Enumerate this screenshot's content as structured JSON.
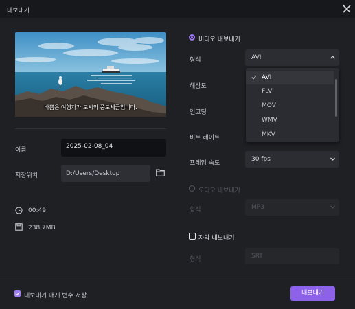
{
  "window": {
    "title": "내보내기"
  },
  "preview": {
    "subtitle": "바쁨은 여행자가 도시의 풍토세금입니다."
  },
  "file": {
    "name_label": "이름",
    "name_value": "2025-02-08_04",
    "location_label": "저장위치",
    "location_value": "D:/Users/Desktop",
    "duration": "00:49",
    "size": "238.7MB"
  },
  "video_export": {
    "title": "비디오 내보내기",
    "format_label": "형식",
    "format_value": "AVI",
    "resolution_label": "해상도",
    "encoding_label": "인코딩",
    "bitrate_label": "비트 레이트",
    "framerate_label": "프레임 속도",
    "framerate_value": "30  fps",
    "format_options": [
      "AVI",
      "FLV",
      "MOV",
      "WMV",
      "MKV"
    ]
  },
  "audio_export": {
    "title": "오디오 내보내기",
    "format_label": "형식",
    "format_value": "MP3"
  },
  "subtitle_export": {
    "title": "자막 내보내기",
    "format_label": "형식",
    "format_value": "SRT"
  },
  "footer": {
    "save_params_label": "내보내기 매개 변수 저장",
    "export_button": "내보내기"
  },
  "colors": {
    "accent": "#8d62e8",
    "background": "#1f2024"
  }
}
